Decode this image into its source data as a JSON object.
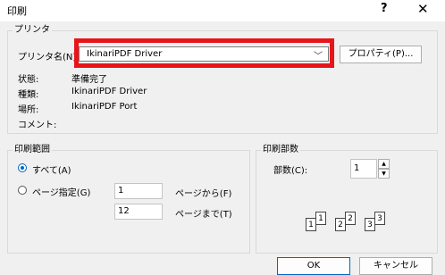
{
  "window": {
    "title": "印刷",
    "help": "?",
    "close": "✕"
  },
  "printer": {
    "group_label": "プリンタ",
    "name_label": "プリンタ名(N):",
    "selected": "IkinariPDF Driver",
    "properties_button": "プロパティ(P)...",
    "status_label": "状態:",
    "status_value": "準備完了",
    "type_label": "種類:",
    "type_value": "IkinariPDF Driver",
    "location_label": "場所:",
    "location_value": "IkinariPDF Port",
    "comment_label": "コメント:"
  },
  "range": {
    "group_label": "印刷範囲",
    "all_label": "すべて(A)",
    "pages_label": "ページ指定(G)",
    "from_value": "1",
    "from_label": "ページから(F)",
    "to_value": "12",
    "to_label": "ページまで(T)",
    "selected": "all"
  },
  "copies": {
    "group_label": "印刷部数",
    "count_label": "部数(C):",
    "count_value": "1",
    "collate_pages": [
      "1",
      "1",
      "2",
      "2",
      "3",
      "3"
    ]
  },
  "buttons": {
    "ok": "OK",
    "cancel": "キャンセル"
  },
  "colors": {
    "highlight": "#e8141b",
    "accent": "#0067c0"
  },
  "icons": {
    "dropdown": "chevron-down-icon",
    "spin_up": "▲",
    "spin_down": "▼"
  }
}
